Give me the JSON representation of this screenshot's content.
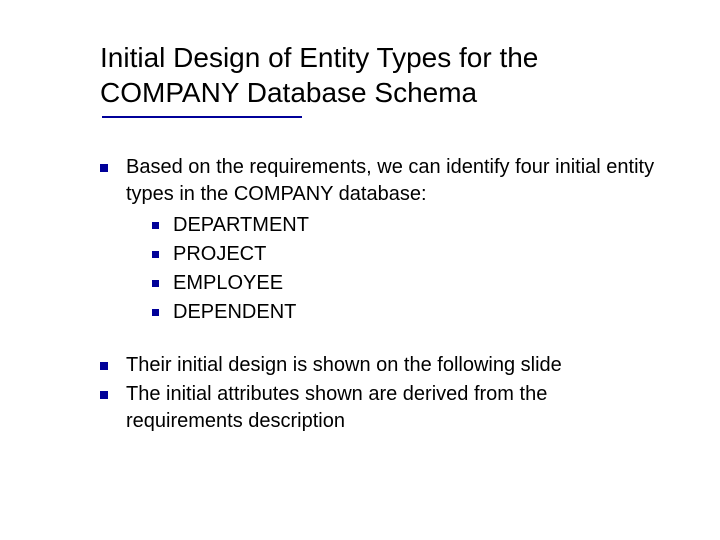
{
  "title": "Initial Design of Entity Types for the COMPANY Database Schema",
  "bullets": {
    "intro": "Based on the requirements, we can identify four initial entity types in the COMPANY database:",
    "entities": [
      "DEPARTMENT",
      "PROJECT",
      "EMPLOYEE",
      "DEPENDENT"
    ],
    "point2": "Their initial design is shown on the following slide",
    "point3": "The initial attributes shown are derived from the requirements description"
  }
}
